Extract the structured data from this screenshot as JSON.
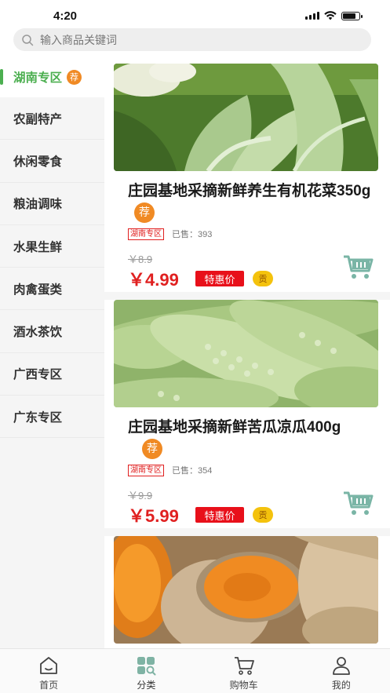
{
  "status": {
    "time": "4:20"
  },
  "search": {
    "placeholder": "输入商品关键词"
  },
  "sidebar": {
    "items": [
      {
        "label": "湖南专区",
        "badge": "荐",
        "active": true
      },
      {
        "label": "农副特产"
      },
      {
        "label": "休闲零食"
      },
      {
        "label": "粮油调味"
      },
      {
        "label": "水果生鲜"
      },
      {
        "label": "肉禽蛋类"
      },
      {
        "label": "酒水茶饮"
      },
      {
        "label": "广西专区"
      },
      {
        "label": "广东专区"
      }
    ]
  },
  "products": [
    {
      "title": "庄园基地采摘新鲜养生有机花菜350g",
      "badge": "荐",
      "region": "湖南专区",
      "sold": "已售：393",
      "original_price": "￥8.9",
      "price": "￥4.99",
      "sale_label": "特惠价",
      "gong": "贡",
      "image": "cauliflower"
    },
    {
      "title": "庄园基地采摘新鲜苦瓜凉瓜400g",
      "badge": "荐",
      "region": "湖南专区",
      "sold": "已售：354",
      "original_price": "￥9.9",
      "price": "￥5.99",
      "sale_label": "特惠价",
      "gong": "贡",
      "image": "bitter-melon"
    },
    {
      "image": "pumpkin"
    }
  ],
  "bottom_nav": [
    {
      "label": "首页",
      "icon": "home-icon"
    },
    {
      "label": "分类",
      "icon": "category-icon",
      "active": true
    },
    {
      "label": "购物车",
      "icon": "cart-icon"
    },
    {
      "label": "我的",
      "icon": "user-icon"
    }
  ],
  "colors": {
    "accent": "#4caf50",
    "price": "#e02020",
    "badge": "#f08a24",
    "cart": "#7ab5a6"
  }
}
